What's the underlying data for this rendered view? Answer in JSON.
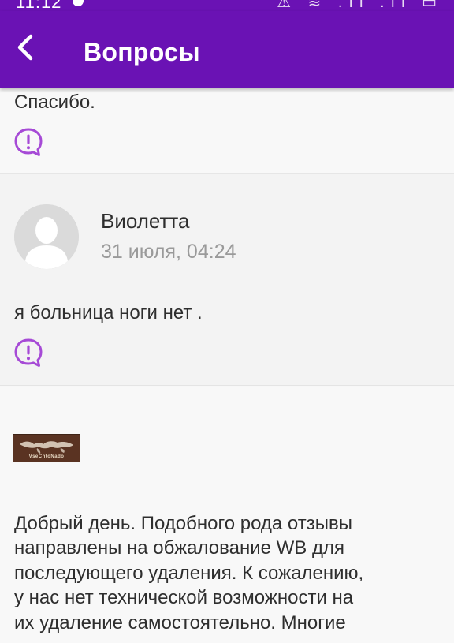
{
  "status_bar": {
    "time": "11:12",
    "icons_text": "⚠ ≋ .ıl .ıl ▭"
  },
  "header": {
    "title": "Вопросы",
    "background": "#6a12b4"
  },
  "icons": {
    "back": "chevron-left-icon",
    "report": "report-bubble-icon",
    "avatar": "user-silhouette-icon"
  },
  "feed": [
    {
      "text": "Спасибо."
    },
    {
      "author": "Виолетта",
      "date": "31 июля, 04:24",
      "text": "я больница ноги нет ."
    },
    {
      "brand_logo_text": "VseChtoNado",
      "answer_lines": [
        "Добрый день. Подобного рода отзывы",
        "направлены на обжалование WB для",
        "последующего удаления. К сожалению,",
        "у нас нет технической возможности на",
        "их удаление самостоятельно. Многие"
      ]
    }
  ],
  "colors": {
    "accent": "#6a12b4",
    "report_icon": "#a64ad6",
    "date_text": "#9a9a9a"
  }
}
